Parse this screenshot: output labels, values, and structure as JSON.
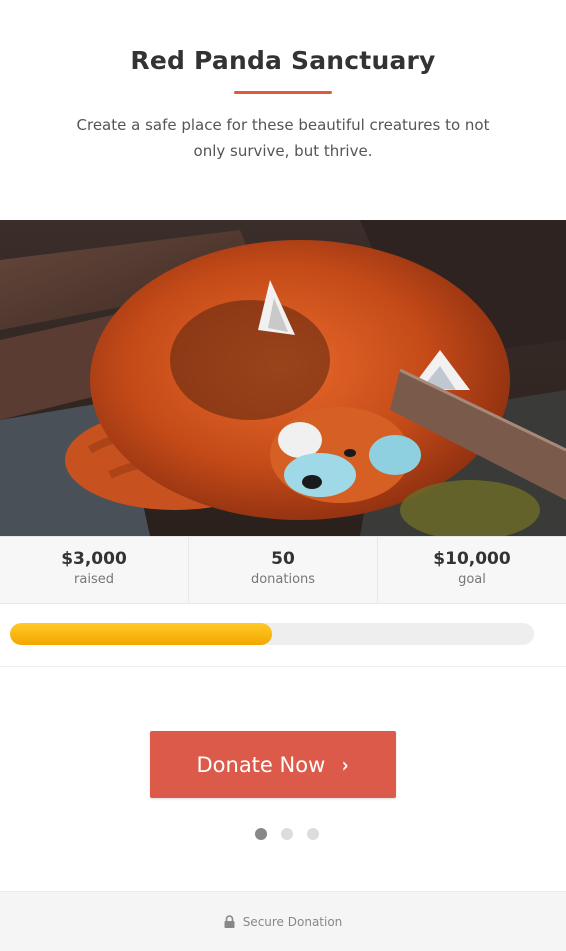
{
  "header": {
    "title": "Red Panda Sanctuary",
    "subtitle": "Create a safe place for these beautiful creatures to not only survive, but thrive."
  },
  "hero": {
    "image_alt": "red-panda-photo"
  },
  "stats": [
    {
      "value": "$3,000",
      "label": "raised"
    },
    {
      "value": "50",
      "label": "donations"
    },
    {
      "value": "$10,000",
      "label": "goal"
    }
  ],
  "progress": {
    "percent": 50
  },
  "donate": {
    "label": "Donate Now",
    "chevron": "›"
  },
  "pagination": {
    "count": 3,
    "active": 0
  },
  "footer": {
    "icon": "lock-icon",
    "label": "Secure Donation"
  },
  "colors": {
    "accent": "#dc5a4a",
    "underline": "#e0593f",
    "progress": "#f4a600"
  }
}
